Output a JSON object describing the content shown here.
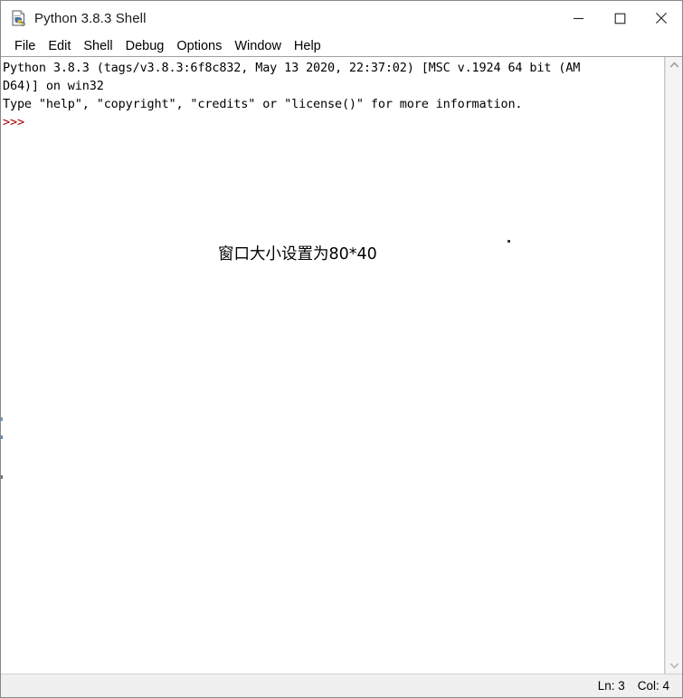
{
  "window": {
    "title": "Python 3.8.3 Shell",
    "icon": "idle-python-icon",
    "controls": {
      "minimize": "—",
      "maximize": "☐",
      "close": "✕"
    }
  },
  "menubar": {
    "items": [
      {
        "label": "File",
        "name": "menu-file"
      },
      {
        "label": "Edit",
        "name": "menu-edit"
      },
      {
        "label": "Shell",
        "name": "menu-shell"
      },
      {
        "label": "Debug",
        "name": "menu-debug"
      },
      {
        "label": "Options",
        "name": "menu-options"
      },
      {
        "label": "Window",
        "name": "menu-window"
      },
      {
        "label": "Help",
        "name": "menu-help"
      }
    ]
  },
  "console": {
    "lines": [
      "Python 3.8.3 (tags/v3.8.3:6f8c832, May 13 2020, 22:37:02) [MSC v.1924 64 bit (AM",
      "D64)] on win32",
      "Type \"help\", \"copyright\", \"credits\" or \"license()\" for more information."
    ],
    "prompt": ">>>",
    "prompt_color": "#a50000",
    "floating_output": "窗口大小设置为80*40"
  },
  "scrollbar": {
    "up_arrow": "⌃",
    "down_arrow": "⌄"
  },
  "statusbar": {
    "line": "Ln: 3",
    "column": "Col: 4"
  }
}
